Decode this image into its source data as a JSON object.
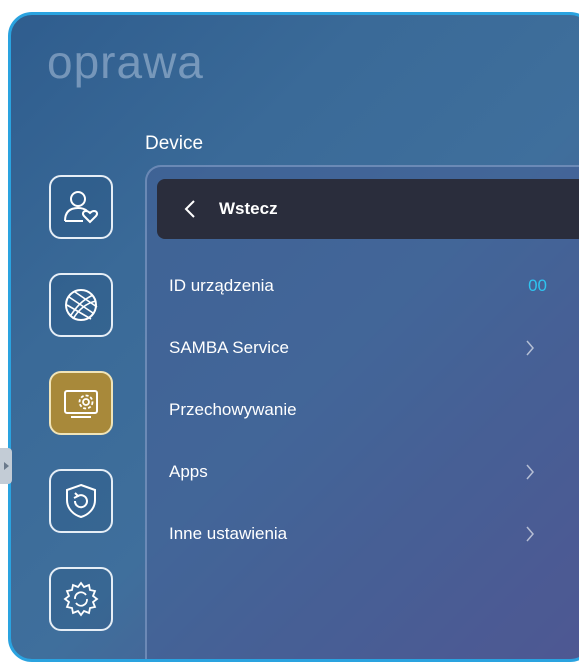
{
  "header": {
    "title": "oprawa",
    "section": "Device"
  },
  "sidebar": {
    "items": [
      {
        "icon": "user-heart-icon",
        "active": false
      },
      {
        "icon": "globe-icon",
        "active": false
      },
      {
        "icon": "device-settings-icon",
        "active": true
      },
      {
        "icon": "shield-restore-icon",
        "active": false
      },
      {
        "icon": "gear-refresh-icon",
        "active": false
      }
    ]
  },
  "panel": {
    "back_label": "Wstecz",
    "items": [
      {
        "label": "ID urządzenia",
        "value": "00"
      },
      {
        "label": "SAMBA Service",
        "chevron": true
      },
      {
        "label": "Przechowywanie"
      },
      {
        "label": "Apps",
        "chevron": true
      },
      {
        "label": "Inne ustawienia",
        "chevron": true
      }
    ]
  },
  "colors": {
    "frame": "#2aa3e0",
    "accent_value": "#2ec4f0",
    "active_icon_bg": "#a8893a"
  }
}
